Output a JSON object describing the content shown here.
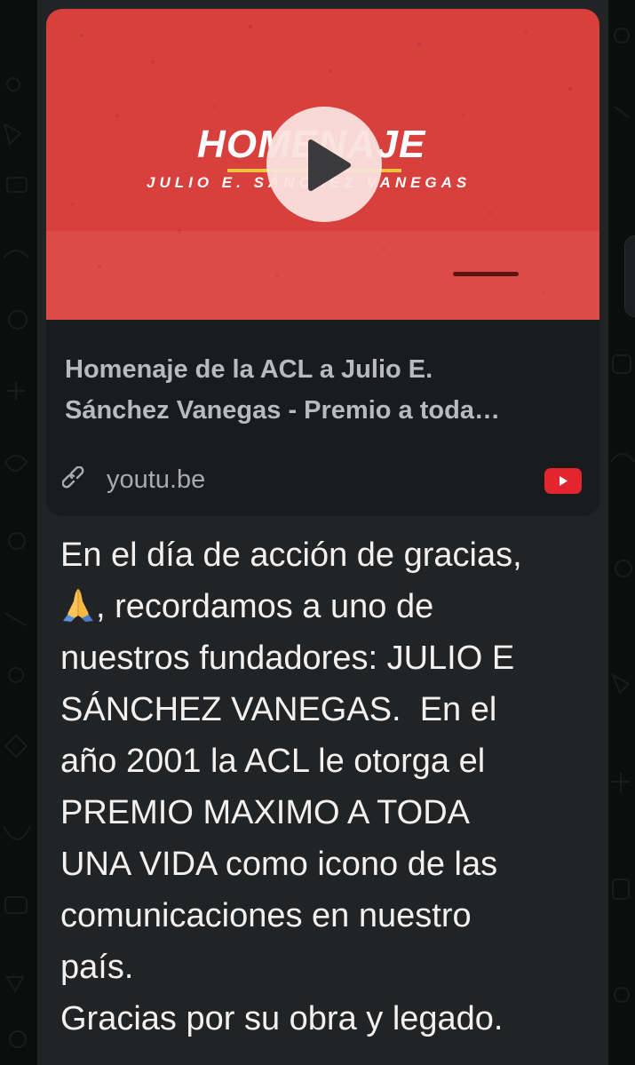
{
  "link_preview": {
    "thumbnail": {
      "title": "HOMENAJE",
      "subtitle": "JULIO E. SÁNCHEZ VANEGAS",
      "background_color": "#d8403e",
      "accent_color": "#f2c53d"
    },
    "play_icon": "play-icon",
    "title_line1": "Homenaje de la ACL a Julio E.",
    "title_line2": "Sánchez Vanegas - Premio a toda…",
    "link_icon": "link-icon",
    "domain": "youtu.be",
    "source_icon": "youtube-icon",
    "source_color": "#e4242f"
  },
  "message": {
    "line1": "En el día de acción de gracias,",
    "line2_emoji": "🙏",
    "line2_text": ", recordamos a uno de",
    "line3": "nuestros fundadores: JULIO E",
    "line4": "SÁNCHEZ VANEGAS.  En el",
    "line5": "año 2001 la ACL le otorga el",
    "line6": "PREMIO MAXIMO A TODA",
    "line7": "UNA VIDA como icono de las",
    "line8": "comunicaciones en nuestro",
    "line9": "país.",
    "line10": "Gracias por su obra y legado."
  },
  "theme": {
    "background": "#0c0d0d",
    "bubble": "#222324",
    "text": "#f1f1f1"
  }
}
